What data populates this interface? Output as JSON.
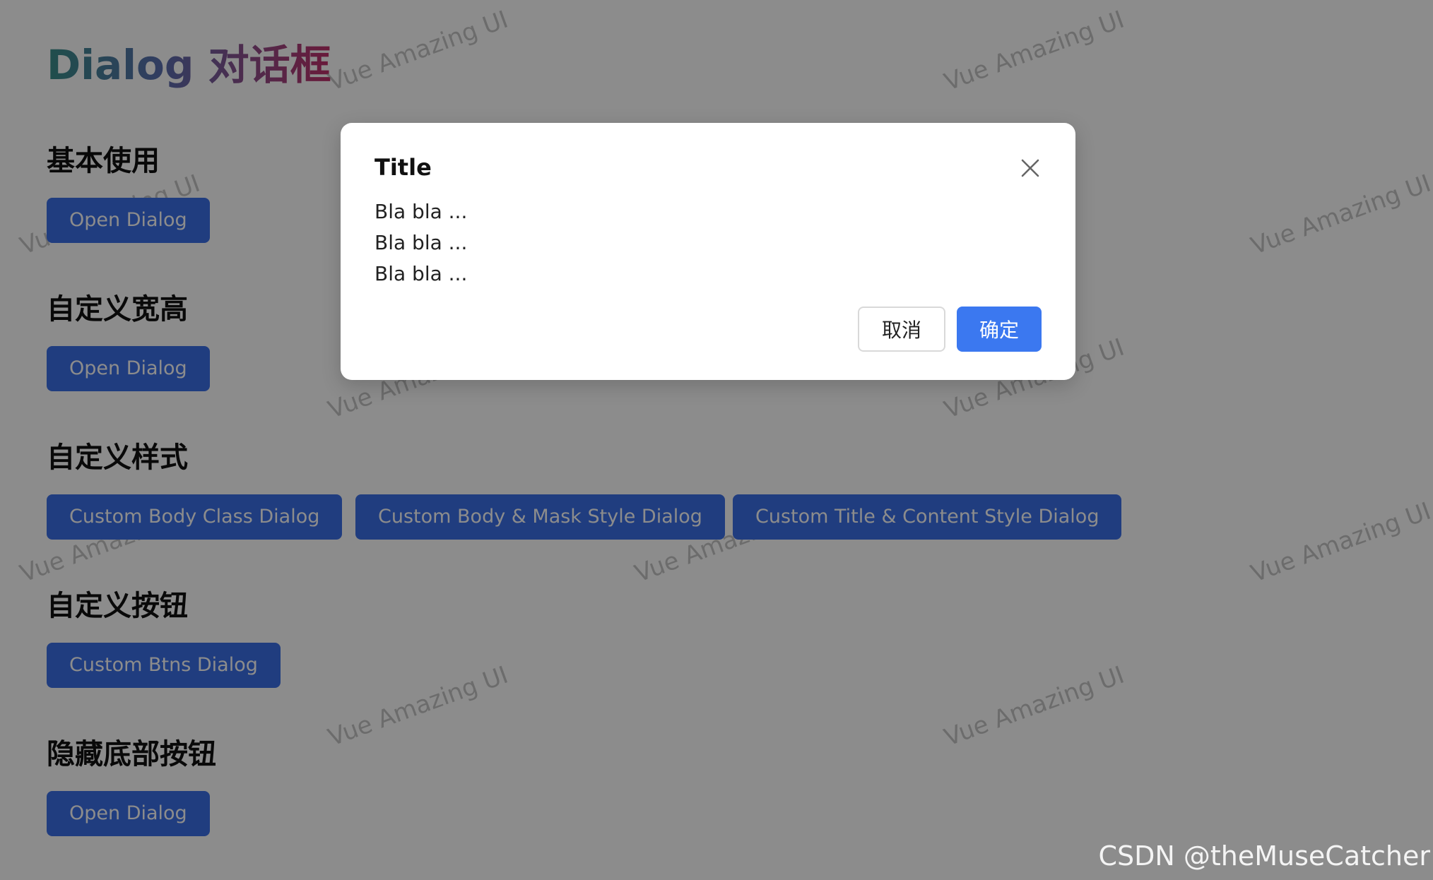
{
  "page": {
    "title": "Dialog 对话框",
    "watermark_text": "Vue Amazing UI",
    "csdn_watermark": "CSDN @theMuseCatcher"
  },
  "sections": [
    {
      "title": "基本使用",
      "buttons": [
        "Open Dialog"
      ]
    },
    {
      "title": "自定义宽高",
      "buttons": [
        "Open Dialog"
      ]
    },
    {
      "title": "自定义样式",
      "buttons": [
        "Custom Body Class Dialog",
        "Custom Body & Mask Style Dialog",
        "Custom Title & Content Style Dialog"
      ]
    },
    {
      "title": "自定义按钮",
      "buttons": [
        "Custom Btns Dialog"
      ]
    },
    {
      "title": "隐藏底部按钮",
      "buttons": [
        "Open Dialog"
      ]
    }
  ],
  "dialog": {
    "title": "Title",
    "content": [
      "Bla bla ...",
      "Bla bla ...",
      "Bla bla ..."
    ],
    "cancel_label": "取消",
    "confirm_label": "确定"
  },
  "colors": {
    "primary": "#3b6fe8",
    "confirm": "#3b78f0",
    "mask": "rgba(0,0,0,0.45)"
  },
  "icons": {
    "close": "close-icon"
  }
}
